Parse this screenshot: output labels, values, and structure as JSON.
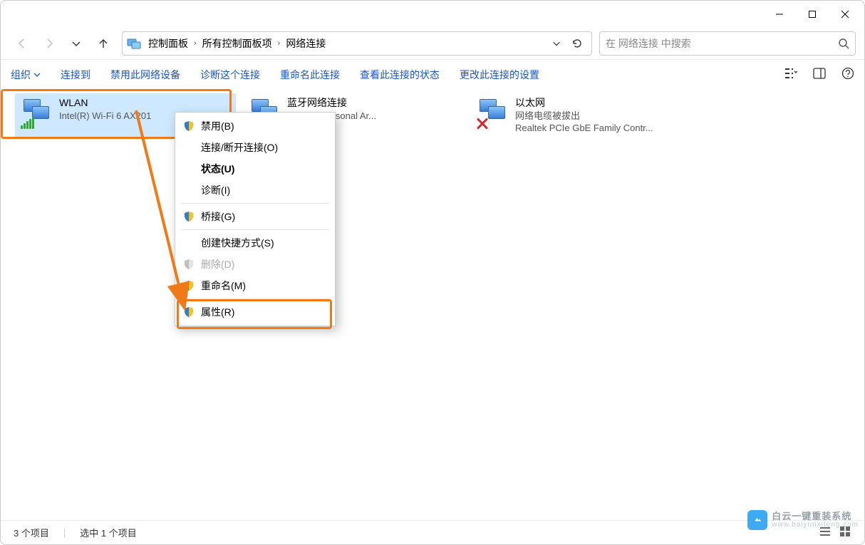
{
  "breadcrumbs": [
    "控制面板",
    "所有控制面板项",
    "网络连接"
  ],
  "search_placeholder": "在 网络连接 中搜索",
  "commands": {
    "organize": "组织",
    "connect_to": "连接到",
    "disable_device": "禁用此网络设备",
    "diagnose": "诊断这个连接",
    "rename": "重命名此连接",
    "view_status": "查看此连接的状态",
    "change_settings": "更改此连接的设置"
  },
  "adapters": [
    {
      "name": "WLAN",
      "status": "",
      "device": "Intel(R) Wi-Fi 6 AX201",
      "selected": true,
      "wifi": true
    },
    {
      "name": "蓝牙网络连接",
      "status": "",
      "device": "Device (Personal Ar...",
      "selected": false
    },
    {
      "name": "以太网",
      "status": "网络电缆被拔出",
      "device": "Realtek PCIe GbE Family Contr...",
      "selected": false,
      "disconnected": true
    }
  ],
  "context_menu": [
    {
      "label": "禁用(B)",
      "shield": true
    },
    {
      "label": "连接/断开连接(O)"
    },
    {
      "label": "状态(U)",
      "bold": true
    },
    {
      "label": "诊断(I)"
    },
    {
      "sep": true
    },
    {
      "label": "桥接(G)",
      "shield": true
    },
    {
      "sep": true
    },
    {
      "label": "创建快捷方式(S)"
    },
    {
      "label": "删除(D)",
      "shield": true,
      "disabled": true
    },
    {
      "label": "重命名(M)",
      "shield": true
    },
    {
      "sep": true
    },
    {
      "label": "属性(R)",
      "shield": true
    }
  ],
  "statusbar": {
    "count": "3 个项目",
    "selected": "选中 1 个项目"
  },
  "watermark": {
    "line1": "白云一键重装系统",
    "line2": "www.baiyunxitong.com"
  }
}
